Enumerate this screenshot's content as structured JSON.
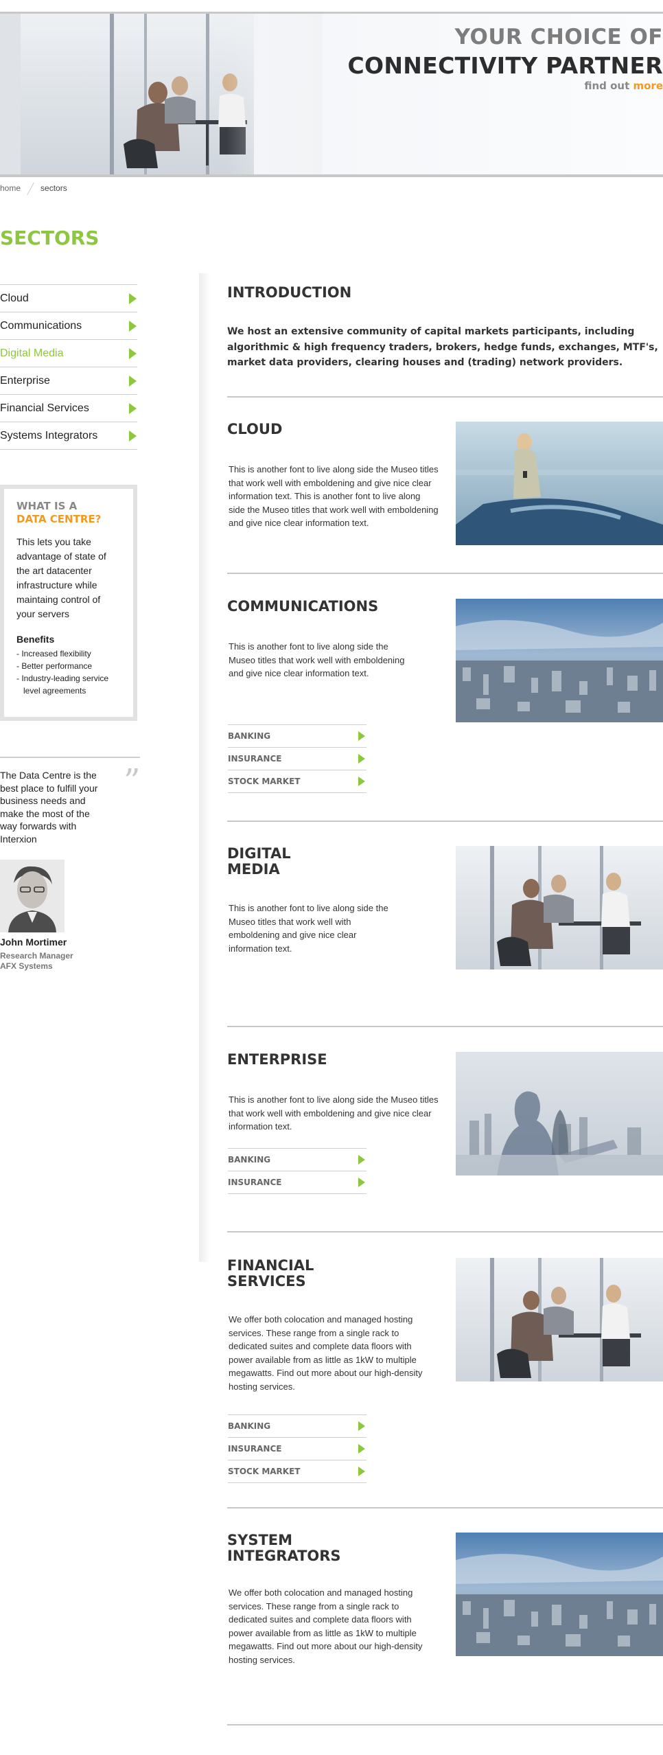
{
  "hero": {
    "title_line1": "YOUR CHOICE OF",
    "title_line2": "CONNECTIVITY PARTNER",
    "link_text": "find out",
    "link_highlight": "more",
    "accent_color": "#f39a1e"
  },
  "breadcrumb": {
    "home": "home",
    "current": "sectors"
  },
  "page_title": "SECTORS",
  "sidebar": {
    "items": [
      {
        "label": "Cloud"
      },
      {
        "label": "Communications"
      },
      {
        "label": "Digital Media"
      },
      {
        "label": "Enterprise"
      },
      {
        "label": "Financial Services"
      },
      {
        "label": "Systems Integrators"
      }
    ],
    "active": "Digital Media",
    "accent_color": "#8dc63f"
  },
  "datacentre": {
    "heading_line1": "WHAT IS A",
    "heading_line2": "DATA CENTRE?",
    "text": "This lets you take advantage of state of the art datacenter infrastructure while maintaing control of your servers",
    "benefits_heading": "Benefits",
    "benefits": [
      "- Increased flexibility",
      "- Better performance",
      "- Industry-leading service level agreements"
    ]
  },
  "testimonial": {
    "quote": "The Data Centre is the best place to fulfill your business needs and make the most of the way forwards with Interxion",
    "name": "John Mortimer",
    "role": "Research Manager",
    "company": "AFX Systems"
  },
  "intro": {
    "title": "INTRODUCTION",
    "text": "We host an extensive community of capital markets participants, including algorithmic & high frequency traders, brokers, hedge funds, exchanges, MTF's, market data providers, clearing houses and (trading) network providers."
  },
  "sections": [
    {
      "title_lines": [
        "CLOUD"
      ],
      "text": "This is another font to live along side the Museo titles that work well with emboldening and give nice clear information text.  This is another font to live along side the Museo titles that work well with emboldening and give nice clear information text.",
      "links": []
    },
    {
      "title_lines": [
        "COMMUNICATIONS"
      ],
      "text": "This is another font to live along side the Museo titles that work well with emboldening and give nice clear information text.",
      "links": [
        "BANKING",
        "INSURANCE",
        "STOCK MARKET"
      ]
    },
    {
      "title_lines": [
        "DIGITAL",
        "MEDIA"
      ],
      "text": "This is another font to live along side the Museo titles that work well with emboldening and give nice clear information text.",
      "links": []
    },
    {
      "title_lines": [
        "ENTERPRISE"
      ],
      "text": "This is another font to live along side the Museo titles that work well with emboldening and give nice clear information text.",
      "links": [
        "BANKING",
        "INSURANCE"
      ]
    },
    {
      "title_lines": [
        "FINANCIAL",
        "SERVICES"
      ],
      "text": "We offer both colocation and managed hosting services. These range from a single rack to dedicated suites and complete data floors with power available from as little as 1kW to multiple megawatts. Find out more about our high-density hosting services.",
      "links": [
        "BANKING",
        "INSURANCE",
        "STOCK MARKET"
      ]
    },
    {
      "title_lines": [
        "SYSTEM",
        "INTEGRATORS"
      ],
      "text": "We offer both colocation and managed hosting services. These range from a single rack to dedicated suites and complete data floors with power available from as little as 1kW to multiple megawatts. Find out more about our high-density hosting services.",
      "links": []
    }
  ]
}
